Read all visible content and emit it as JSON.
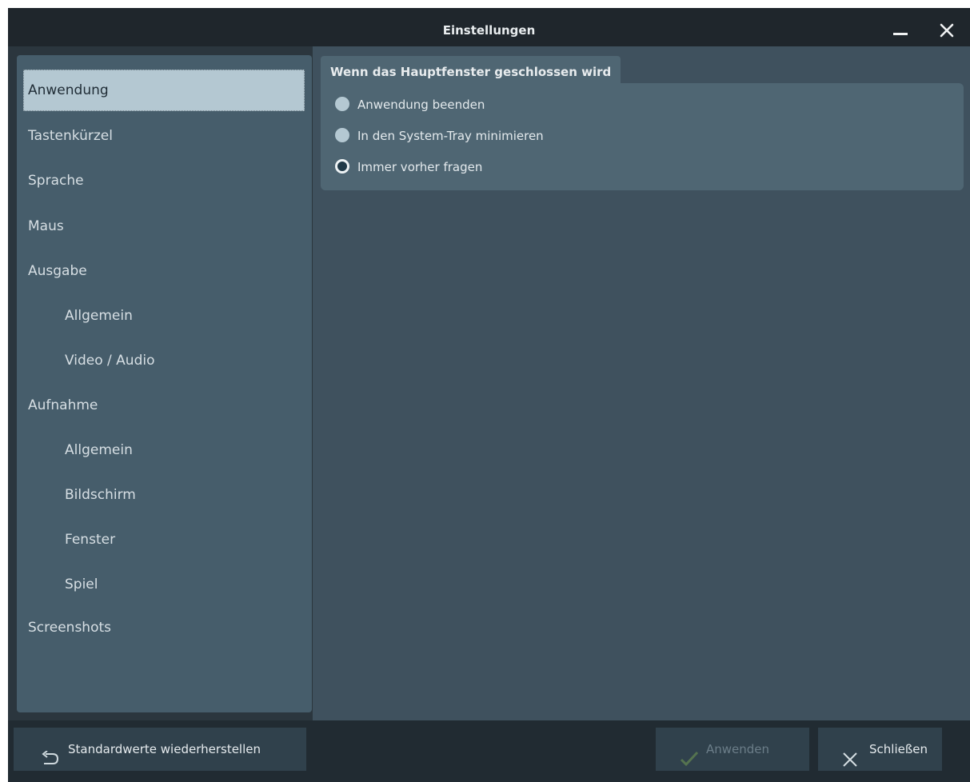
{
  "window": {
    "title": "Einstellungen"
  },
  "nav": {
    "items": [
      {
        "label": "Anwendung",
        "selected": true,
        "level": 0
      },
      {
        "label": "Tastenkürzel",
        "level": 0
      },
      {
        "label": "Sprache",
        "level": 0
      },
      {
        "label": "Maus",
        "level": 0
      },
      {
        "label": "Ausgabe",
        "level": 0
      },
      {
        "label": "Allgemein",
        "level": 1
      },
      {
        "label": "Video / Audio",
        "level": 1
      },
      {
        "label": "Aufnahme",
        "level": 0
      },
      {
        "label": "Allgemein",
        "level": 1
      },
      {
        "label": "Bildschirm",
        "level": 1
      },
      {
        "label": "Fenster",
        "level": 1
      },
      {
        "label": "Spiel",
        "level": 1
      },
      {
        "label": "Screenshots",
        "level": 0
      }
    ]
  },
  "group": {
    "title": "Wenn das Hauptfenster geschlossen wird",
    "options": [
      {
        "label": "Anwendung beenden",
        "checked": false
      },
      {
        "label": "In den System-Tray minimieren",
        "checked": false
      },
      {
        "label": "Immer vorher fragen",
        "checked": true
      }
    ]
  },
  "footer": {
    "restore_label": "Standardwerte wiederherstellen",
    "apply_label": "Anwenden",
    "apply_enabled": false,
    "close_label": "Schließen"
  },
  "colors": {
    "selected_item": "#b4c8d2",
    "sidebar": "#465d6b",
    "content": "#3f515e",
    "titlebar": "#1f262c"
  }
}
